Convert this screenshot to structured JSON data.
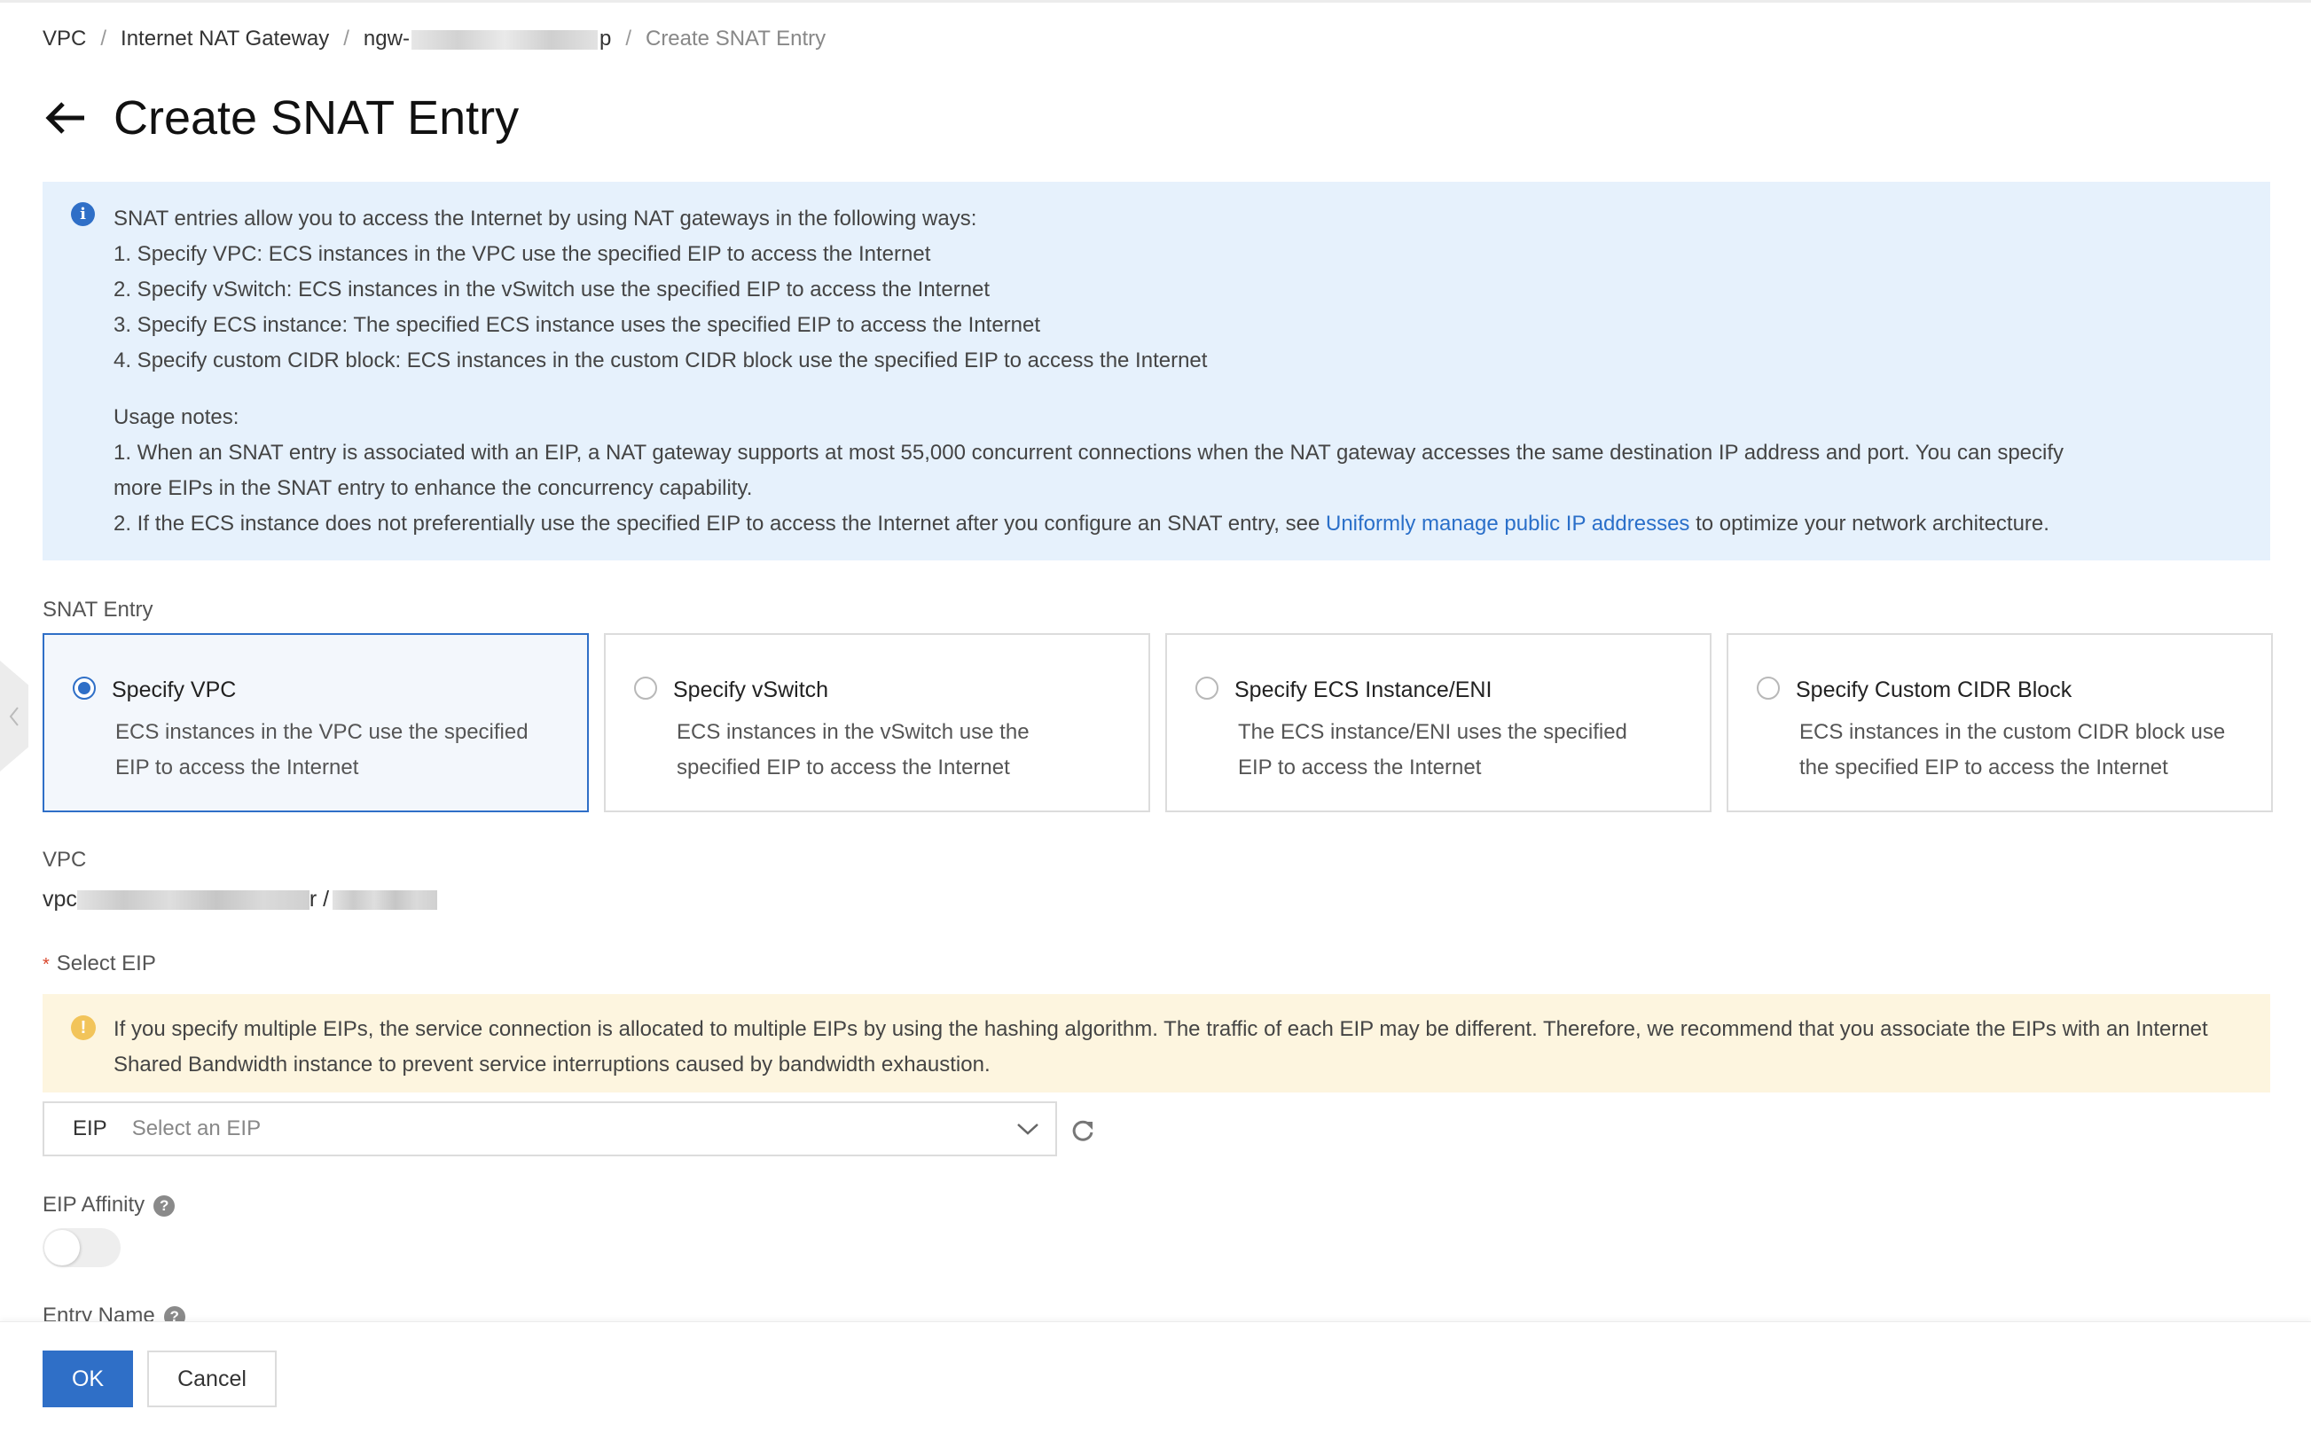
{
  "breadcrumb": {
    "items": [
      "VPC",
      "Internet NAT Gateway",
      "ngw-",
      "Create SNAT Entry"
    ],
    "gateway_suffix": "p",
    "separator": "/"
  },
  "header": {
    "title": "Create SNAT Entry",
    "back_icon": "arrow-left-icon"
  },
  "info": {
    "icon": "info-icon",
    "intro": "SNAT entries allow you to access the Internet by using NAT gateways in the following ways:",
    "ways": [
      "1. Specify VPC: ECS instances in the VPC use the specified EIP to access the Internet",
      "2. Specify vSwitch: ECS instances in the vSwitch use the specified EIP to access the Internet",
      "3. Specify ECS instance: The specified ECS instance uses the specified EIP to access the Internet",
      "4. Specify custom CIDR block: ECS instances in the custom CIDR block use the specified EIP to access the Internet"
    ],
    "usage_title": "Usage notes:",
    "note1_line1": "1. When an SNAT entry is associated with an EIP, a NAT gateway supports at most 55,000 concurrent connections when the NAT gateway accesses the same destination IP address and port. You can specify",
    "note1_line2": "more EIPs in the SNAT entry to enhance the concurrency capability.",
    "note2_before": "2. If the ECS instance does not preferentially use the specified EIP to access the Internet after you configure an SNAT entry, see ",
    "note2_link": "Uniformly manage public IP addresses",
    "note2_after": " to optimize your network architecture."
  },
  "snat_entry": {
    "label": "SNAT Entry",
    "selected_index": 0,
    "options": [
      {
        "title": "Specify VPC",
        "description": "ECS instances in the VPC use the specified EIP to access the Internet"
      },
      {
        "title": "Specify vSwitch",
        "description": "ECS instances in the vSwitch use the specified EIP to access the Internet"
      },
      {
        "title": "Specify ECS Instance/ENI",
        "description": "The ECS instance/ENI uses the specified EIP to access the Internet"
      },
      {
        "title": "Specify Custom CIDR Block",
        "description": "ECS instances in the custom CIDR block use the specified EIP to access the Internet"
      }
    ]
  },
  "vpc": {
    "label": "VPC",
    "value_prefix": "vpc",
    "value_mid": "r /"
  },
  "select_eip": {
    "label": "Select EIP",
    "required_mark": "*",
    "warning": "If you specify multiple EIPs, the service connection is allocated to multiple EIPs by using the hashing algorithm. The traffic of each EIP may be different. Therefore, we recommend that you associate the EIPs with an Internet Shared Bandwidth instance to prevent service interruptions caused by bandwidth exhaustion.",
    "prefix": "EIP",
    "placeholder": "Select an EIP"
  },
  "eip_affinity": {
    "label": "EIP Affinity",
    "enabled": false
  },
  "entry_name": {
    "label": "Entry Name"
  },
  "footer": {
    "ok_label": "OK",
    "cancel_label": "Cancel"
  },
  "colors": {
    "primary": "#2f6fc7",
    "info_bg": "#e6f1fc",
    "warning_bg": "#fdf5df",
    "warning_icon": "#f2c45a"
  }
}
